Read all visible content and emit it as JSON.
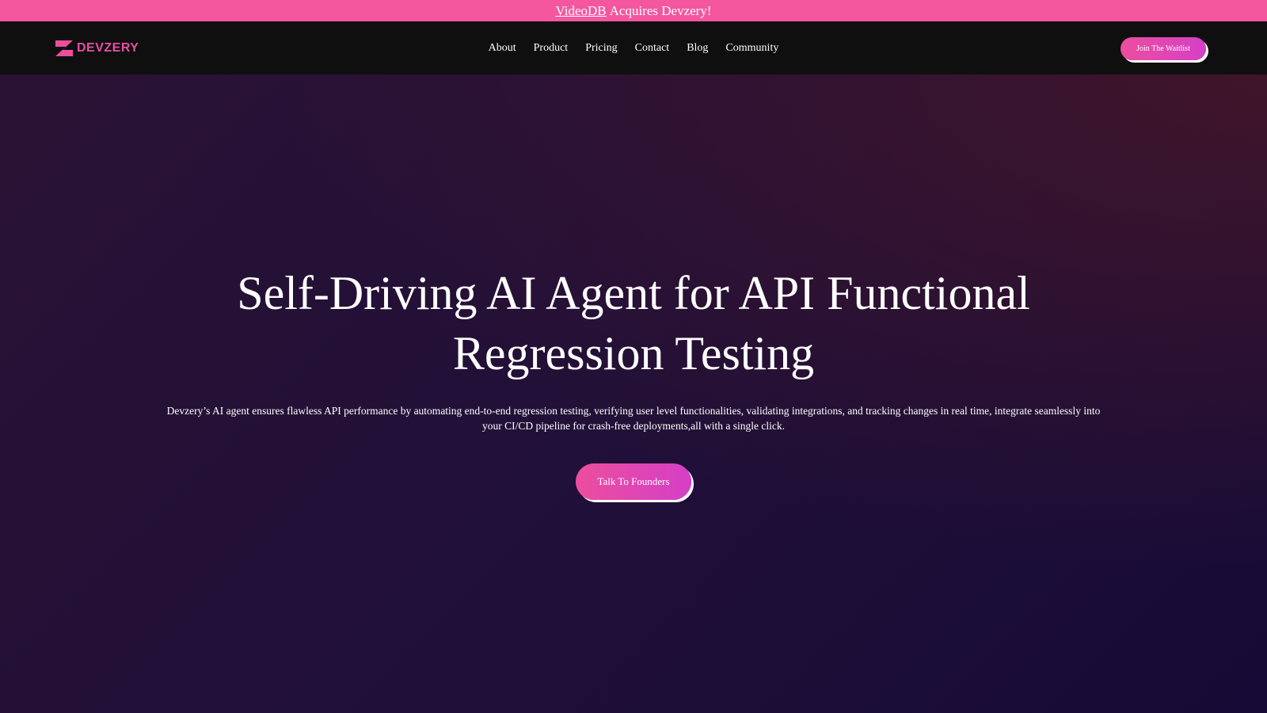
{
  "announcement": {
    "link_text": "VideoDB",
    "text": "Acquires Devzery!"
  },
  "brand": {
    "name": "DEVZERY",
    "logo_icon": "z-logo-icon",
    "accent_color": "#ec4e9e",
    "accent_color_2": "#d53fc6"
  },
  "nav": {
    "items": [
      {
        "label": "About"
      },
      {
        "label": "Product"
      },
      {
        "label": "Pricing"
      },
      {
        "label": "Contact"
      },
      {
        "label": "Blog"
      },
      {
        "label": "Community"
      }
    ],
    "cta_label": "Join The Waitlist"
  },
  "hero": {
    "headline": "Self-Driving AI Agent for API Functional Regression Testing",
    "description": "Devzery’s AI agent ensures flawless API performance by automating end-to-end regression testing, verifying user level functionalities, validating integrations, and tracking changes in real time, integrate seamlessly into your CI/CD pipeline for crash-free deployments,all with a single click.",
    "cta_label": "Talk To Founders"
  }
}
